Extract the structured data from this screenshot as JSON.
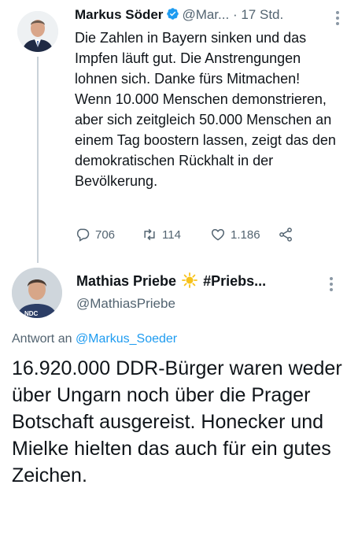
{
  "tweet1": {
    "author_name": "Markus Söder",
    "handle": "@Mar...",
    "separator": "·",
    "time": "17 Std.",
    "text": "Die Zahlen in Bayern sinken und das Impfen läuft gut. Die Anstrengungen lohnen sich. Danke fürs Mitmachen! Wenn 10.000 Menschen demonstrieren, aber sich zeitgleich 50.000 Menschen an einem Tag boostern lassen, zeigt das den demokratischen Rückhalt in der Bevölkerung.",
    "reply_count": "706",
    "retweet_count": "114",
    "like_count": "1.186"
  },
  "tweet2": {
    "author_name": "Mathias Priebe",
    "name_suffix": "#Priebs...",
    "handle": "@MathiasPriebe",
    "replying_prefix": "Antwort an",
    "replying_to": "@Markus_Soeder",
    "text": "16.920.000 DDR-Bürger waren weder über Ungarn noch über die Prager Botschaft ausgereist. Honecker und Mielke hielten das auch für ein gutes Zeichen."
  },
  "icons": {
    "verified": "verified-badge-icon",
    "sun": "sun-emoji-icon",
    "reply": "reply-icon",
    "retweet": "retweet-icon",
    "like": "heart-icon",
    "share": "share-icon",
    "more": "more-options-icon"
  },
  "colors": {
    "accent": "#1d9bf0",
    "muted_text": "#536471",
    "primary_text": "#0f1419",
    "background": "#ffffff"
  }
}
